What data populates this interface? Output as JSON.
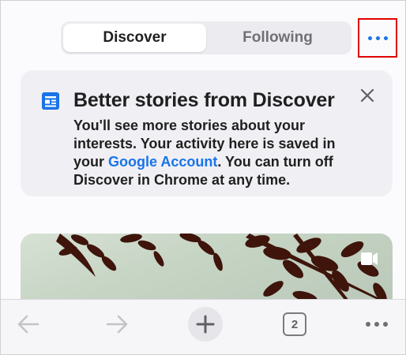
{
  "tabs": {
    "discover": "Discover",
    "following": "Following"
  },
  "card": {
    "title": "Better stories from Discover",
    "body_part1": "You'll see more stories about your interests. Your activity here is saved in your ",
    "link": "Google Account",
    "body_part2": ". You can turn off Discover in Chrome at any time."
  },
  "toolbar": {
    "tab_count": "2"
  },
  "icons": {
    "menu": "more-horizontal-icon",
    "card_icon": "news-icon",
    "close": "close-icon",
    "back": "arrow-left-icon",
    "forward": "arrow-right-icon",
    "new_tab": "plus-icon",
    "tabs": "tab-switcher-icon",
    "overflow": "more-horizontal-icon"
  },
  "colors": {
    "accent": "#1a73e8",
    "highlight": "#e00000"
  }
}
